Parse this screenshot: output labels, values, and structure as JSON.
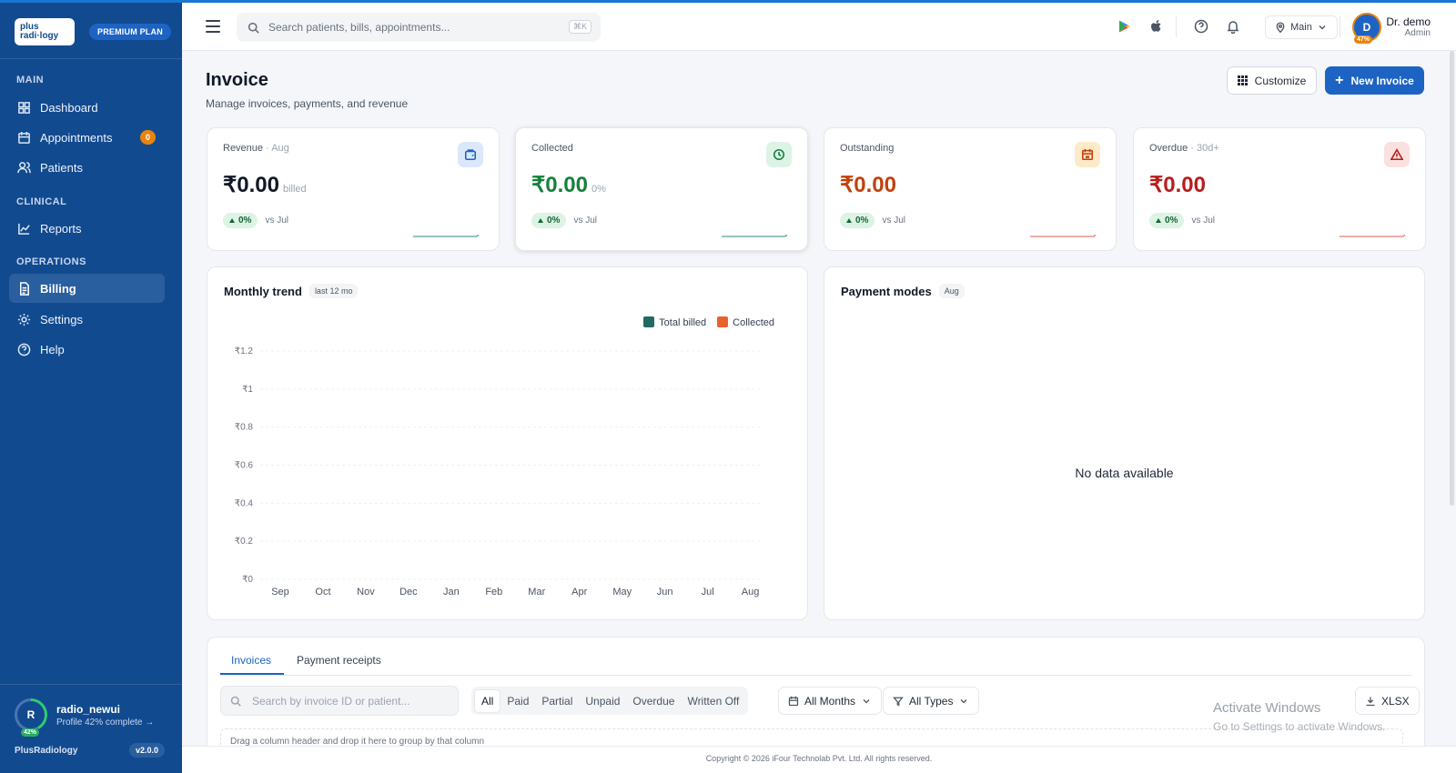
{
  "brand": {
    "logo_line1": "plus",
    "logo_line2": "radi·logy",
    "plan": "PREMIUM PLAN",
    "footer_name": "PlusRadiology",
    "version": "v2.0.0"
  },
  "sidebar": {
    "sections": [
      {
        "label": "MAIN"
      },
      {
        "label": "CLINICAL"
      },
      {
        "label": "OPERATIONS"
      }
    ],
    "items": [
      {
        "label": "Dashboard",
        "icon": "grid-icon"
      },
      {
        "label": "Appointments",
        "icon": "calendar-icon",
        "badge": "0"
      },
      {
        "label": "Patients",
        "icon": "users-icon"
      },
      {
        "label": "Reports",
        "icon": "chart-line-icon"
      },
      {
        "label": "Billing",
        "icon": "document-icon",
        "active": true
      },
      {
        "label": "Settings",
        "icon": "gear-icon"
      },
      {
        "label": "Help",
        "icon": "help-circle-icon"
      }
    ],
    "profile": {
      "initial": "R",
      "percent": "42%",
      "name": "radio_newui",
      "subtitle": "Profile 42% complete →"
    }
  },
  "header": {
    "search_placeholder": "Search patients, bills, appointments...",
    "shortcut": "⌘K",
    "location": "Main",
    "user": {
      "initial": "D",
      "percent": "47%",
      "name": "Dr. demo",
      "role": "Admin"
    }
  },
  "page": {
    "title": "Invoice",
    "subtitle": "Manage invoices, payments, and revenue",
    "customize_label": "Customize",
    "new_label": "New Invoice"
  },
  "kpis": [
    {
      "label": "Revenue",
      "qualifier": " · Aug",
      "value": "₹0.00",
      "suffix": "billed",
      "change": "0%",
      "compare": "vs Jul",
      "color": "#111827",
      "icon_bg": "#dbe8fb",
      "icon_color": "#1d63c4",
      "spark": "#2a8a7a"
    },
    {
      "label": "Collected",
      "qualifier": "",
      "value": "₹0.00",
      "suffix": "0%",
      "change": "0%",
      "compare": "vs Jul",
      "color": "#15803d",
      "icon_bg": "#dcf3e5",
      "icon_color": "#15803d",
      "spark": "#2a8a7a"
    },
    {
      "label": "Outstanding",
      "qualifier": "",
      "value": "₹0.00",
      "suffix": "",
      "change": "0%",
      "compare": "vs Jul",
      "color": "#c2410c",
      "icon_bg": "#fdebc8",
      "icon_color": "#c2410c",
      "spark": "#e05a47"
    },
    {
      "label": "Overdue",
      "qualifier": " · 30d+",
      "value": "₹0.00",
      "suffix": "",
      "change": "0%",
      "compare": "vs Jul",
      "color": "#b91c1c",
      "icon_bg": "#fbe0e0",
      "icon_color": "#b91c1c",
      "spark": "#e05a47"
    }
  ],
  "trend": {
    "title": "Monthly trend",
    "chip": "last 12 mo"
  },
  "chart_data": {
    "type": "bar",
    "title": "",
    "categories": [
      "Sep",
      "Oct",
      "Nov",
      "Dec",
      "Jan",
      "Feb",
      "Mar",
      "Apr",
      "May",
      "Jun",
      "Jul",
      "Aug"
    ],
    "series": [
      {
        "name": "Total billed",
        "color": "#1f6b63",
        "values": [
          0,
          0,
          0,
          0,
          0,
          0,
          0,
          0,
          0,
          0,
          0,
          0
        ]
      },
      {
        "name": "Collected",
        "color": "#e8622c",
        "values": [
          0,
          0,
          0,
          0,
          0,
          0,
          0,
          0,
          0,
          0,
          0,
          0
        ]
      }
    ],
    "yticks": [
      "₹0",
      "₹0.2",
      "₹0.4",
      "₹0.6",
      "₹0.8",
      "₹1",
      "₹1.2"
    ],
    "ylim": [
      0,
      1.2
    ],
    "grid": true,
    "legend": "top-right"
  },
  "payment": {
    "title": "Payment modes",
    "chip": "Aug",
    "empty": "No data available"
  },
  "table": {
    "tabs": [
      "Invoices",
      "Payment receipts"
    ],
    "search_placeholder": "Search by invoice ID or patient...",
    "filters": [
      "All",
      "Paid",
      "Partial",
      "Unpaid",
      "Overdue",
      "Written Off"
    ],
    "months_label": "All Months",
    "types_label": "All Types",
    "export_label": "XLSX",
    "group_hint": "Drag a column header and drop it here to group by that column"
  },
  "overlay": {
    "line1": "Activate Windows",
    "line2": "Go to Settings to activate Windows."
  },
  "footer": {
    "copyright": "Copyright © 2026 iFour Technolab Pvt. Ltd. All rights reserved."
  }
}
